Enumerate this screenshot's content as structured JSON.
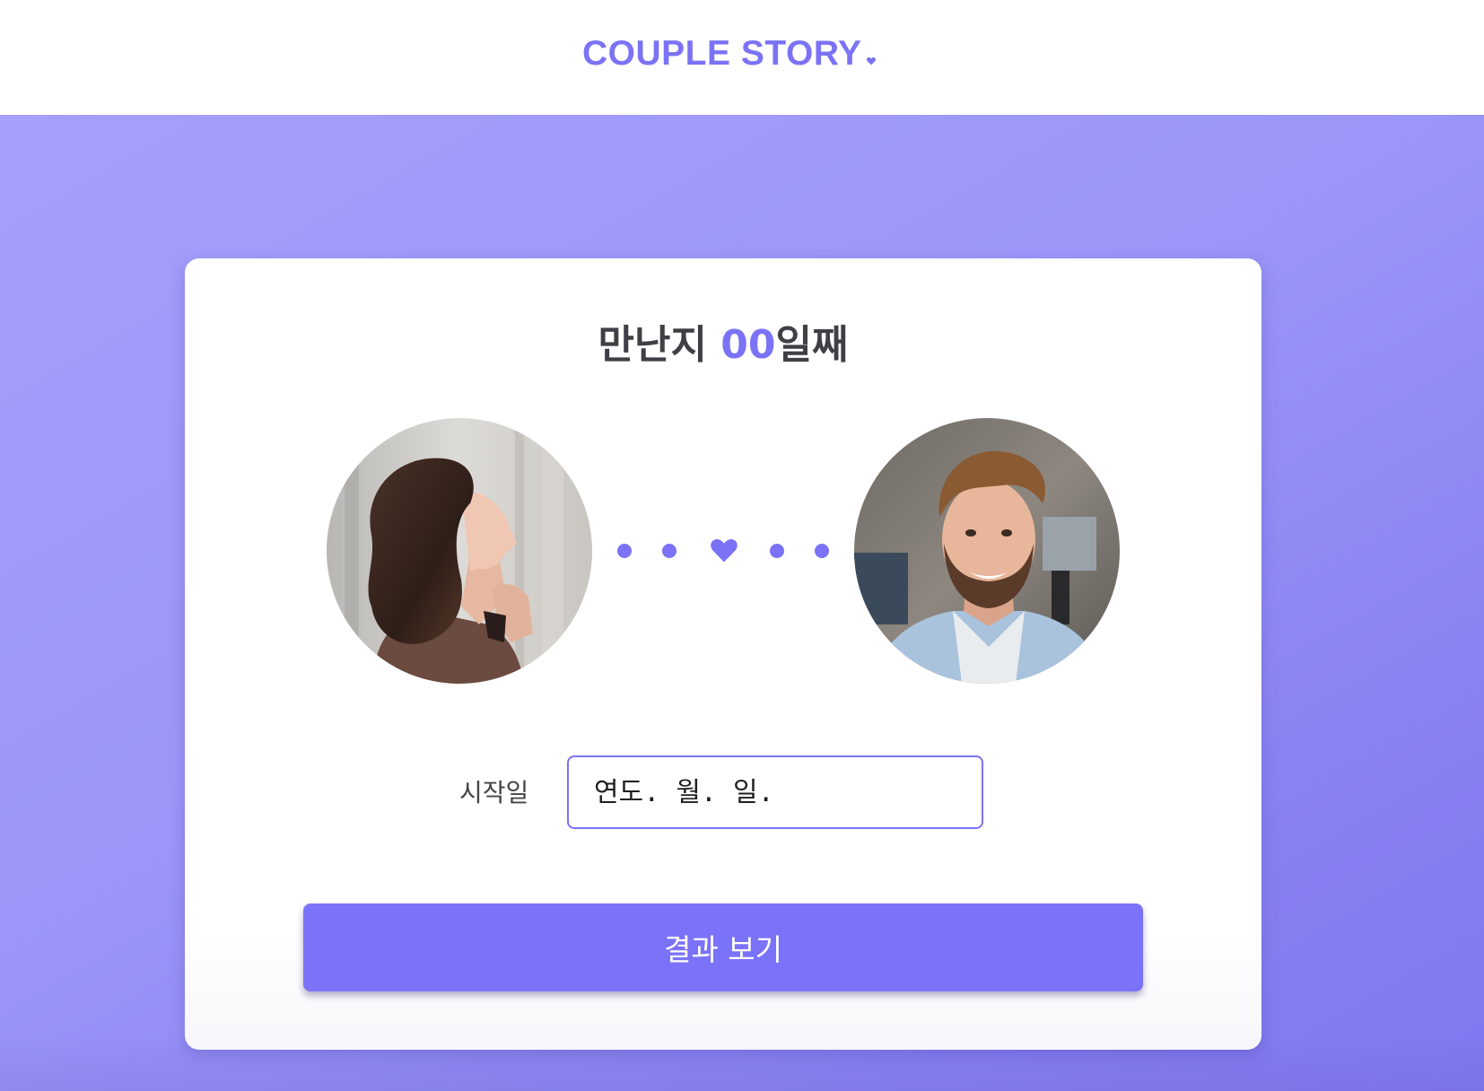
{
  "header": {
    "logo_text": "COUPLE STORY",
    "logo_icon": "heart-icon",
    "brand_color": "#7b72f5"
  },
  "card": {
    "title_prefix": "만난지 ",
    "title_count": "00",
    "title_suffix": "일째",
    "avatars": {
      "left": "woman-photo",
      "right": "man-photo"
    },
    "connector_icon": "heart-icon",
    "date_label": "시작일",
    "date_placeholder": "연도. 월. 일.",
    "submit_label": "결과 보기"
  },
  "colors": {
    "accent": "#7b72f5",
    "button": "#7b72fa",
    "background_gradient_start": "#a5a0fa",
    "background_gradient_end": "#7f77ef",
    "title_text": "#3f3f45"
  }
}
